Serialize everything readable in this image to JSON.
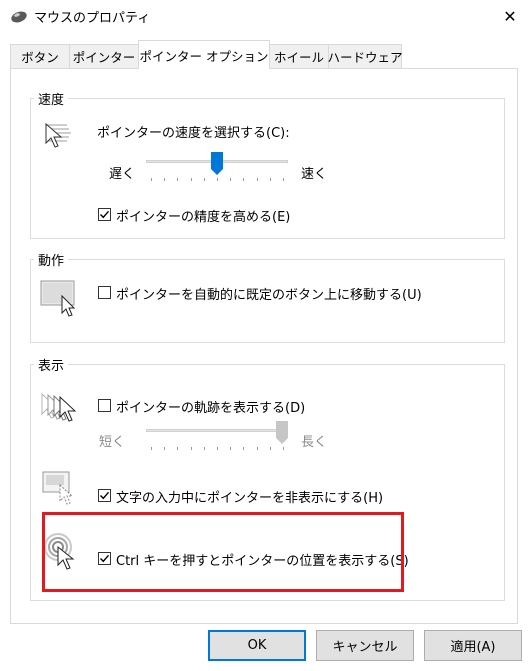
{
  "window": {
    "title": "マウスのプロパティ",
    "close_glyph": "✕"
  },
  "tabs": [
    {
      "label": "ボタン"
    },
    {
      "label": "ポインター"
    },
    {
      "label": "ポインター オプション",
      "active": true
    },
    {
      "label": "ホイール"
    },
    {
      "label": "ハードウェア"
    }
  ],
  "motion": {
    "legend": "速度",
    "speed_label": "ポインターの速度を選択する(C):",
    "slow_label": "遅く",
    "fast_label": "速く",
    "speed_level": 0.5,
    "precision_label": "ポインターの精度を高める(E)",
    "precision_checked": true
  },
  "snap": {
    "legend": "動作",
    "snapto_label": "ポインターを自動的に既定のボタン上に移動する(U)",
    "snapto_checked": false
  },
  "visibility": {
    "legend": "表示",
    "trails_label": "ポインターの軌跡を表示する(D)",
    "trails_checked": false,
    "short_label": "短く",
    "long_label": "長く",
    "trails_level": 1.0,
    "hide_label": "文字の入力中にポインターを非表示にする(H)",
    "hide_checked": true,
    "ctrl_label": "Ctrl キーを押すとポインターの位置を表示する(S)",
    "ctrl_checked": true
  },
  "buttons": {
    "ok": "OK",
    "cancel": "キャンセル",
    "apply": "適用(A)"
  },
  "colors": {
    "highlight": "#e4191f",
    "accent": "#0078d7"
  }
}
